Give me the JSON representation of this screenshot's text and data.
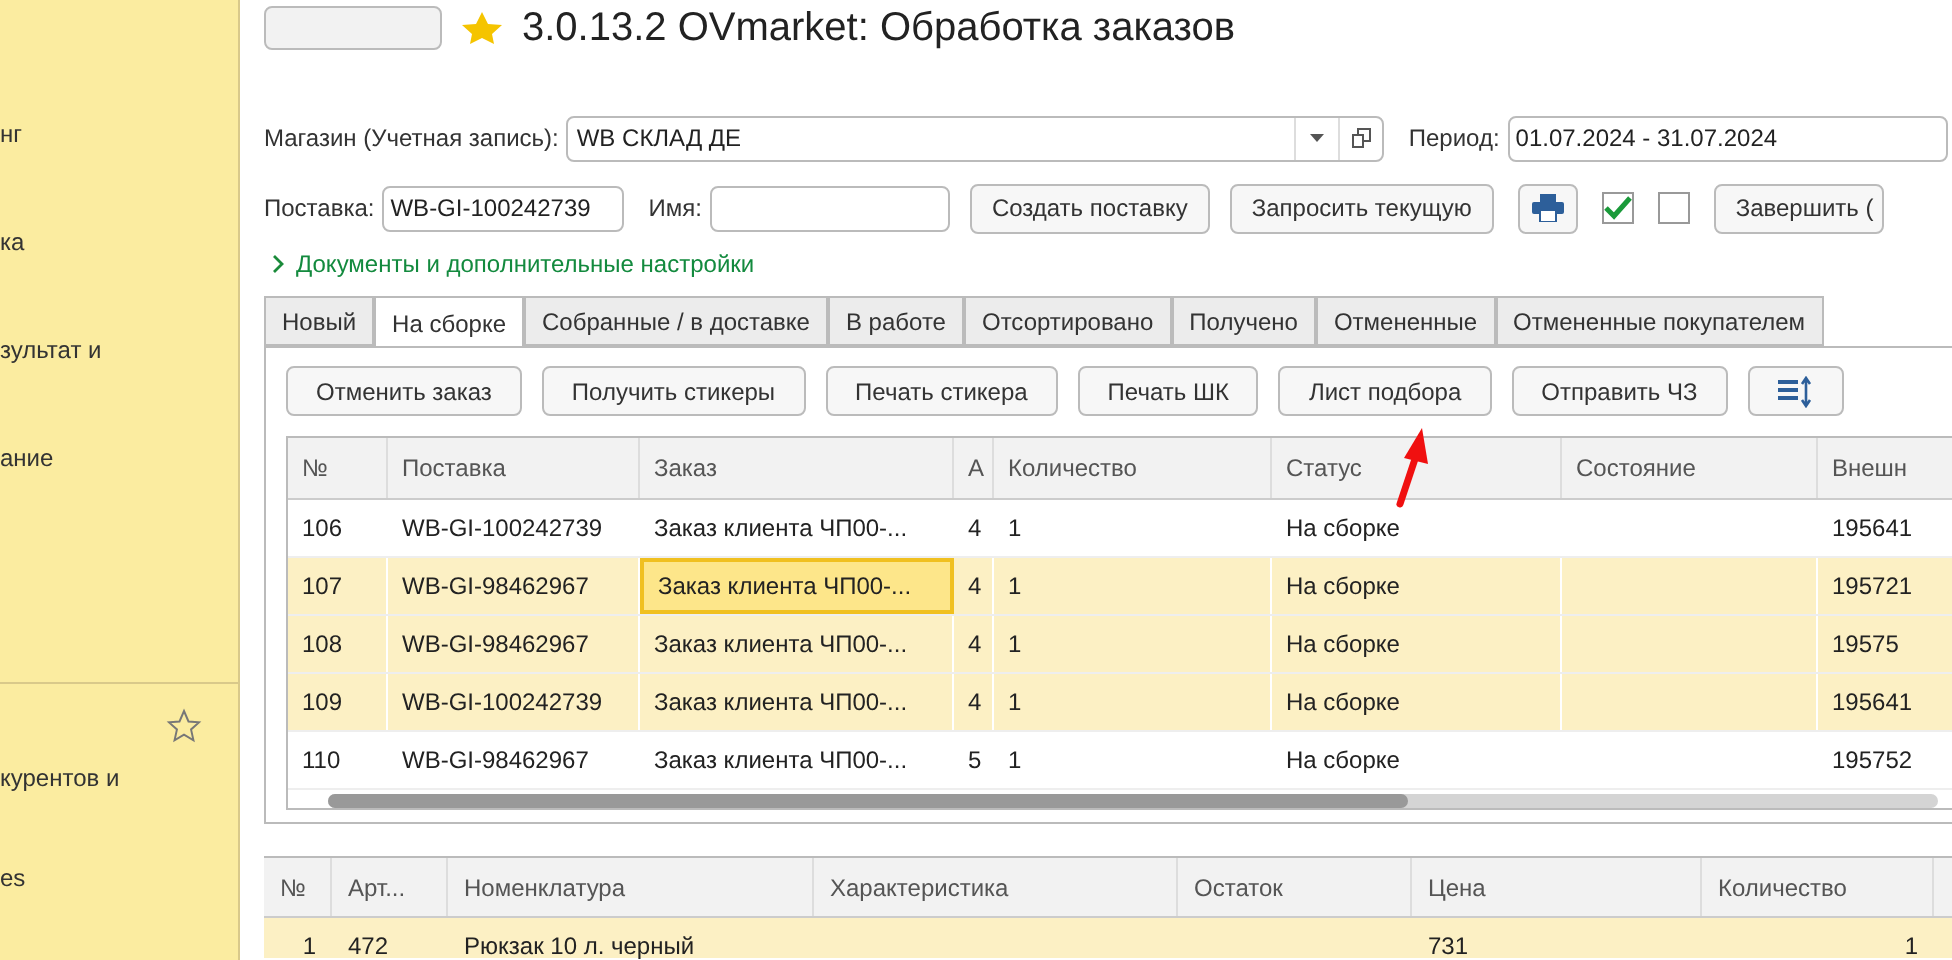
{
  "sidebar": {
    "items": [
      {
        "label": "нг"
      },
      {
        "label": "ка"
      },
      {
        "label": "зультат и"
      },
      {
        "label": "ание"
      }
    ],
    "favorites": {
      "items": [
        {
          "label": "курентов и"
        },
        {
          "label": "es"
        }
      ]
    }
  },
  "window": {
    "title": "3.0.13.2 OVmarket: Обработка заказов"
  },
  "form": {
    "shop_label": "Магазин (Учетная запись):",
    "shop_value": "WB СКЛАД ДЕ",
    "period_label": "Период:",
    "period_value": "01.07.2024 - 31.07.2024",
    "supply_label": "Поставка:",
    "supply_value": "WB-GI-100242739",
    "name_label": "Имя:",
    "buttons": [
      "Создать поставку",
      "Запросить текущую"
    ],
    "checkboxes": [
      {
        "checked": true
      },
      {
        "checked": false
      }
    ],
    "finish_button": "Завершить (",
    "section_link": "Документы и дополнительные настройки"
  },
  "tabs": [
    {
      "label": "Новый",
      "selected": false
    },
    {
      "label": "На сборке",
      "selected": true
    },
    {
      "label": "Собранные / в доставке",
      "selected": false
    },
    {
      "label": "В работе",
      "selected": false
    },
    {
      "label": "Отсортировано",
      "selected": false
    },
    {
      "label": "Получено",
      "selected": false
    },
    {
      "label": "Отмененные",
      "selected": false
    },
    {
      "label": "Отмененные покупателем",
      "selected": false
    }
  ],
  "toolbar": [
    "Отменить заказ",
    "Получить стикеры",
    "Печать стикера",
    "Печать ШК",
    "Лист подбора",
    "Отправить ЧЗ"
  ],
  "table": {
    "columns": [
      "№",
      "Поставка",
      "Заказ",
      "А",
      "Количество",
      "Статус",
      "Состояние",
      "Внешн"
    ],
    "rows": [
      {
        "cells": [
          "106",
          "WB-GI-100242739",
          "Заказ клиента ЧП00-...",
          "4",
          "1",
          "На сборке",
          "",
          "195641"
        ],
        "selected": false,
        "current": false
      },
      {
        "cells": [
          "107",
          "WB-GI-98462967",
          "Заказ клиента ЧП00-...",
          "4",
          "1",
          "На сборке",
          "",
          "195721"
        ],
        "selected": true,
        "current": true
      },
      {
        "cells": [
          "108",
          "WB-GI-98462967",
          "Заказ клиента ЧП00-...",
          "4",
          "1",
          "На сборке",
          "",
          "19575"
        ],
        "selected": true,
        "current": false
      },
      {
        "cells": [
          "109",
          "WB-GI-100242739",
          "Заказ клиента ЧП00-...",
          "4",
          "1",
          "На сборке",
          "",
          "195641"
        ],
        "selected": true,
        "current": false
      },
      {
        "cells": [
          "110",
          "WB-GI-98462967",
          "Заказ клиента ЧП00-...",
          "5",
          "1",
          "На сборке",
          "",
          "195752"
        ],
        "selected": false,
        "current": false
      }
    ]
  },
  "items_table": {
    "columns": [
      "№",
      "Арт...",
      "Номенклатура",
      "Характеристика",
      "Остаток",
      "Цена",
      "Количество"
    ],
    "rows": [
      {
        "cells": [
          "1",
          "472",
          "Рюкзак 10 л. черный",
          "",
          "",
          "731",
          "1"
        ],
        "selected": true
      }
    ]
  }
}
